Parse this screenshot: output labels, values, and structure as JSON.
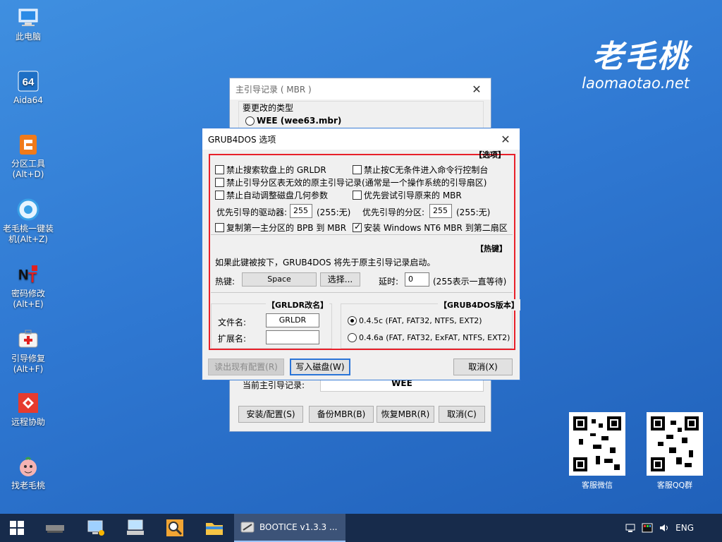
{
  "desktop": {
    "icons": [
      {
        "label": "此电脑",
        "icon": "computer-icon"
      },
      {
        "label": "Aida64",
        "icon": "aida64-icon"
      },
      {
        "label": "分区工具\n(Alt+D)",
        "icon": "partition-tool-icon"
      },
      {
        "label": "老毛桃一键装\n机(Alt+Z)",
        "icon": "one-click-install-icon"
      },
      {
        "label": "密码修改\n(Alt+E)",
        "icon": "password-icon"
      },
      {
        "label": "引导修复\n(Alt+F)",
        "icon": "boot-repair-icon"
      },
      {
        "label": "远程协助",
        "icon": "remote-assist-icon"
      },
      {
        "label": "找老毛桃",
        "icon": "find-laomaotao-icon"
      }
    ],
    "brand_cn": "老毛桃",
    "brand_en": "laomaotao.net",
    "qr_codes": [
      {
        "label": "客服微信"
      },
      {
        "label": "客服QQ群"
      }
    ]
  },
  "mbr_window": {
    "title": "主引导记录 ( MBR )",
    "type_label": "要更改的类型",
    "selected_type": "WEE (wee63.mbr)",
    "current_label": "当前主引导记录:",
    "current_value": "WEE",
    "buttons": {
      "install": "安装/配置(S)",
      "backup": "备份MBR(B)",
      "restore": "恢复MBR(R)",
      "cancel": "取消(C)"
    }
  },
  "grub_dialog": {
    "title": "GRUB4DOS 选项",
    "options_header": "【选项】",
    "options": {
      "no_floppy": {
        "label": "禁止搜索软盘上的 GRLDR",
        "checked": false
      },
      "no_c_console": {
        "label": "禁止按C无条件进入命令行控制台",
        "checked": false
      },
      "no_invalid_mbr": {
        "label": "禁止引导分区表无效的原主引导记录",
        "checked": false
      },
      "no_invalid_mbr_note": "(通常是一个操作系统的引导扇区)",
      "no_geometry": {
        "label": "禁止自动调整磁盘几何参数",
        "checked": false
      },
      "prefer_orig": {
        "label": "优先尝试引导原来的 MBR",
        "checked": false
      },
      "drive_label": "优先引导的驱动器:",
      "drive_value": "255",
      "drive_note": "(255:无)",
      "part_label": "优先引导的分区:",
      "part_value": "255",
      "part_note": "(255:无)",
      "copy_bpb": {
        "label": "复制第一主分区的 BPB 到 MBR",
        "checked": false
      },
      "install_nt6": {
        "label": "安装 Windows NT6 MBR 到第二扇区",
        "checked": true
      }
    },
    "hotkey_header": "【热键】",
    "hotkey_desc": "如果此键被按下，GRUB4DOS 将先于原主引导记录启动。",
    "hotkey_label": "热键:",
    "hotkey_value": "Space",
    "hotkey_select": "选择...",
    "delay_label": "延时:",
    "delay_value": "0",
    "delay_note": "(255表示一直等待)",
    "grldr_header": "【GRLDR改名】",
    "filename_label": "文件名:",
    "filename_value": "GRLDR",
    "ext_label": "扩展名:",
    "ext_value": "",
    "version_header": "【GRUB4DOS版本】",
    "versions": [
      {
        "label": "0.4.5c (FAT, FAT32, NTFS, EXT2)",
        "selected": true
      },
      {
        "label": "0.4.6a (FAT, FAT32, ExFAT, NTFS, EXT2)",
        "selected": false
      }
    ],
    "read_config": "读出现有配置(R)",
    "write_disk": "写入磁盘(W)",
    "cancel": "取消(X)",
    "highlight_color": "#e8202a"
  },
  "taskbar": {
    "app_label": "BOOTICE v1.3.3 ...",
    "lang": "ENG"
  }
}
